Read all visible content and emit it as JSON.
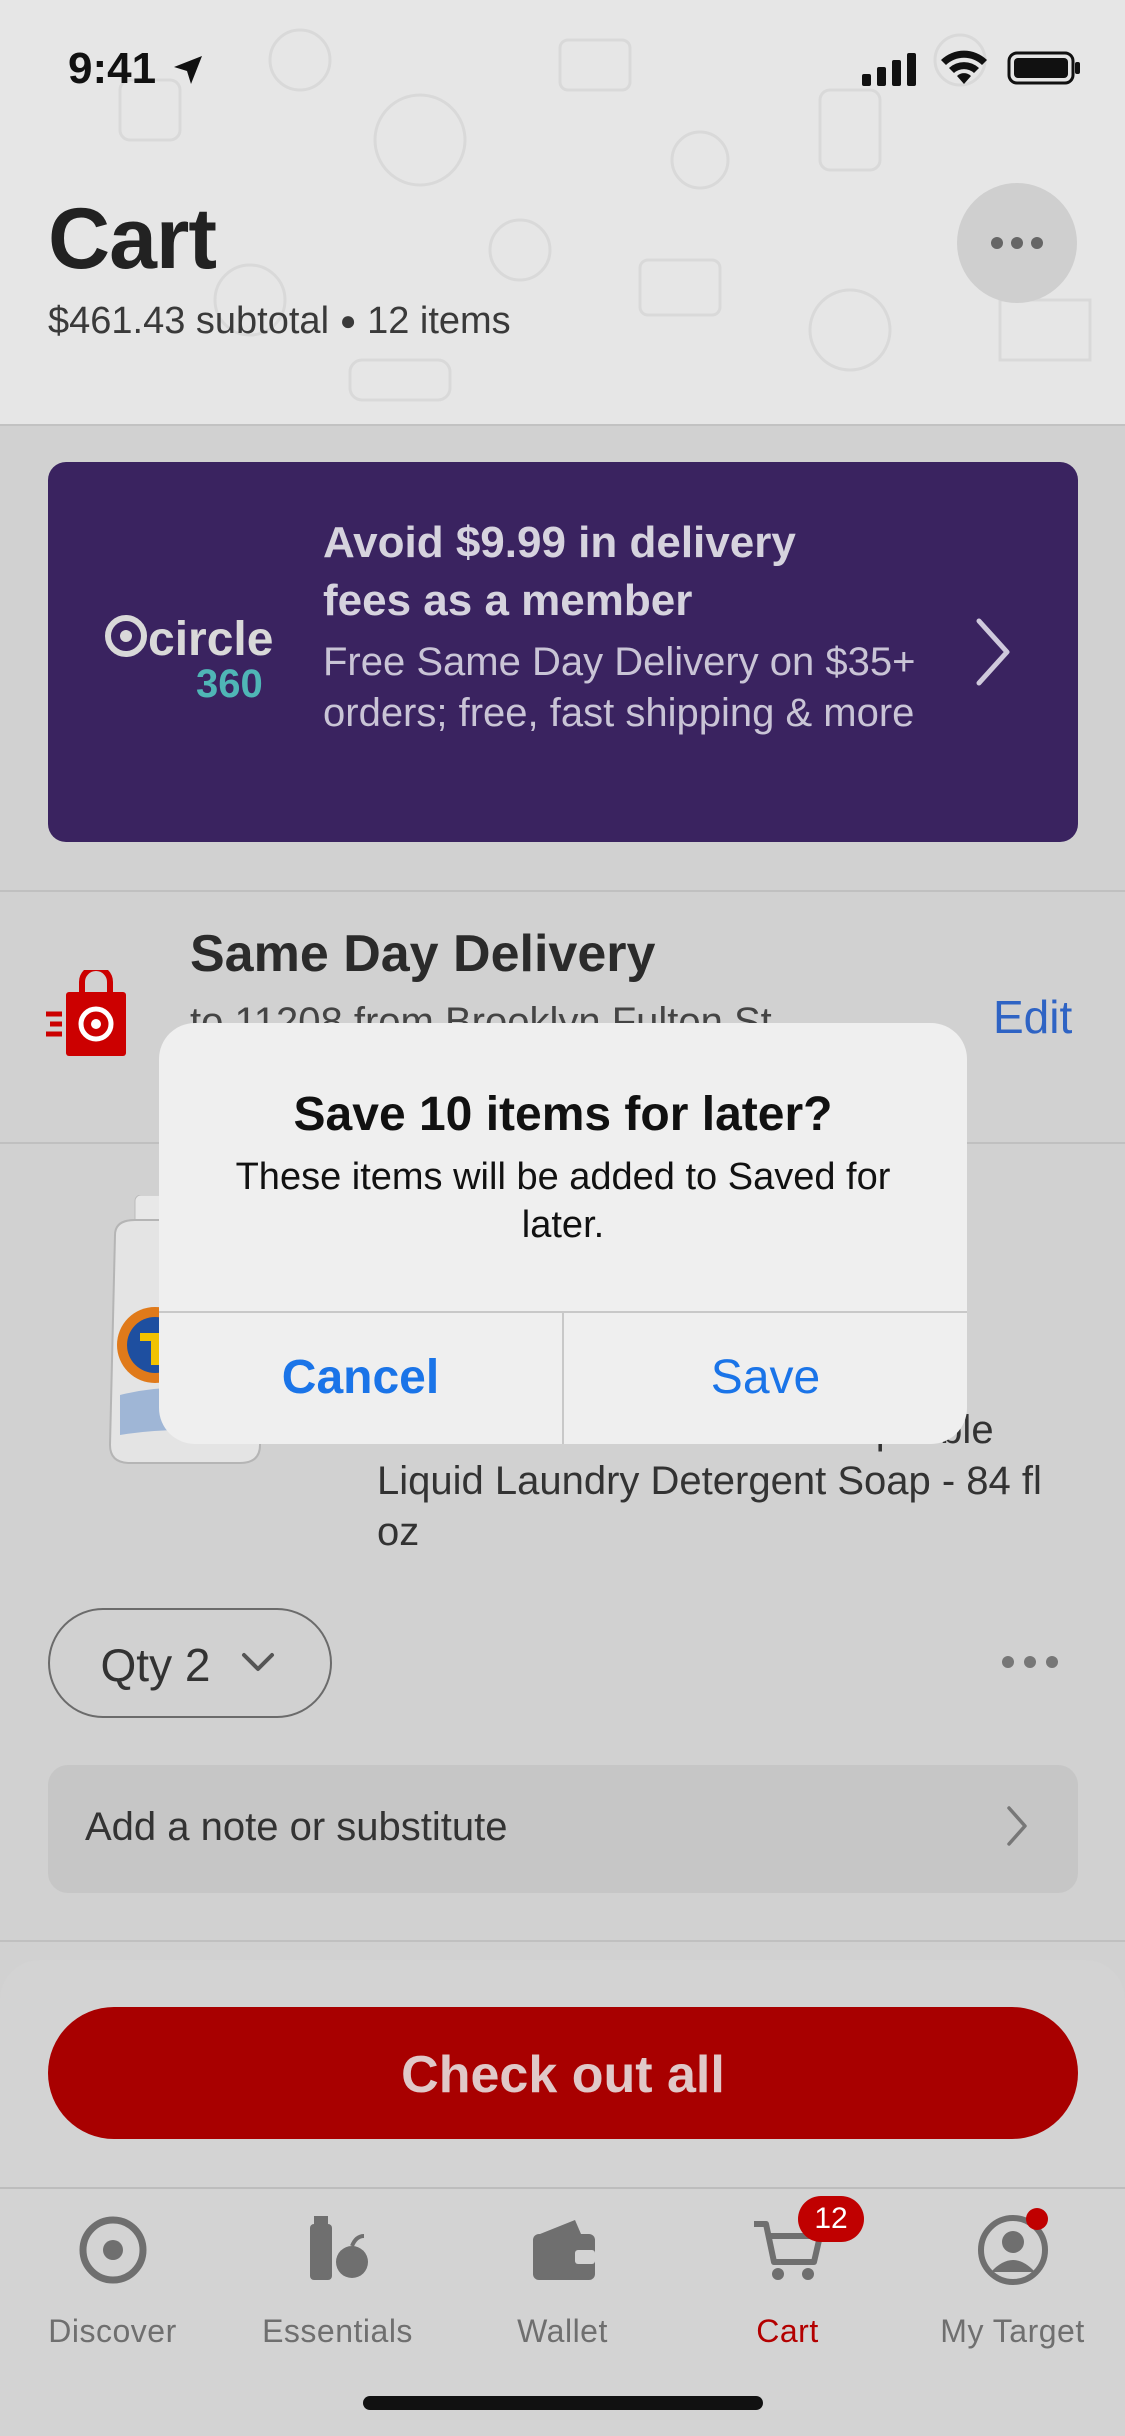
{
  "status_bar": {
    "time": "9:41"
  },
  "header": {
    "title": "Cart",
    "subtotal": "$461.43 subtotal",
    "separator": "●",
    "item_count": "12 items"
  },
  "promo": {
    "logo_word": "circle",
    "logo_number": "360",
    "title": "Avoid $9.99 in delivery fees as a member",
    "description": "Free Same Day Delivery on $35+ orders; free, fast shipping & more"
  },
  "delivery": {
    "title": "Same Day Delivery",
    "subtitle": "to 11208 from Brooklyn Fulton St",
    "edit_label": "Edit"
  },
  "product": {
    "name_visible": "Tide Free & Gentle HE Compatible Liquid Laundry Detergent Soap - 84 fl oz"
  },
  "quantity": {
    "label": "Qty 2"
  },
  "note": {
    "label": "Add a note or substitute"
  },
  "checkout": {
    "label": "Check out all"
  },
  "tabs": [
    {
      "label": "Discover",
      "icon": "target-icon",
      "active": false
    },
    {
      "label": "Essentials",
      "icon": "essentials-icon",
      "active": false
    },
    {
      "label": "Wallet",
      "icon": "wallet-icon",
      "active": false
    },
    {
      "label": "Cart",
      "icon": "cart-icon",
      "active": true,
      "badge": "12"
    },
    {
      "label": "My Target",
      "icon": "profile-icon",
      "active": false
    }
  ],
  "alert": {
    "title": "Save 10 items for later?",
    "message": "These items will be added to Saved for later.",
    "cancel_label": "Cancel",
    "save_label": "Save"
  },
  "colors": {
    "brand_red": "#a80000",
    "promo_purple": "#3a2360",
    "link_blue": "#1a74e8"
  }
}
